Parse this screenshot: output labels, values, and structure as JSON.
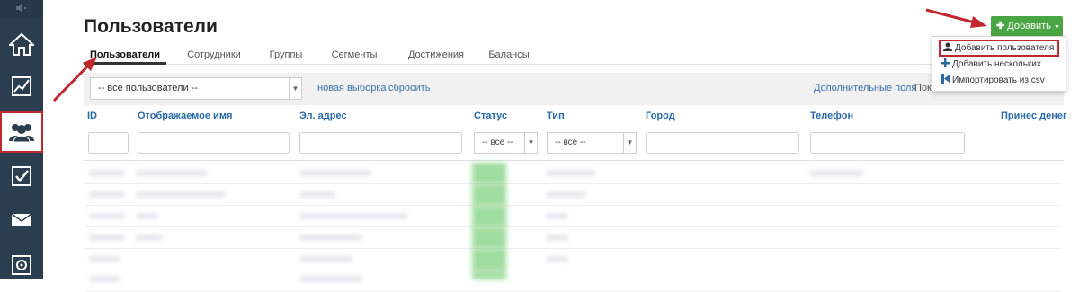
{
  "sidebar": {
    "items": [
      {
        "icon": "home-icon"
      },
      {
        "icon": "chart-icon"
      },
      {
        "icon": "users-icon",
        "active": true
      },
      {
        "icon": "checkbox-icon"
      },
      {
        "icon": "mail-icon"
      },
      {
        "icon": "safe-icon"
      }
    ]
  },
  "page": {
    "title": "Пользователи"
  },
  "tabs": [
    "Пользователи",
    "Сотрудники",
    "Группы",
    "Сегменты",
    "Достижения",
    "Балансы"
  ],
  "filter": {
    "select_value": "-- все пользователи --",
    "new_selection": "новая выборка",
    "reset": "сбросить",
    "extra_fields": "Дополнительные поля",
    "show_truncated": "Пок"
  },
  "table": {
    "headers": [
      "ID",
      "Отображаемое имя",
      "Эл. адрес",
      "Статус",
      "Тип",
      "Город",
      "Телефон",
      "Принес денег"
    ],
    "status_filter": "-- все --",
    "type_filter": "-- все --"
  },
  "add_button": {
    "label": "Добавить",
    "menu": [
      {
        "label": "Добавить пользователя",
        "icon": "user-icon"
      },
      {
        "label": "Добавить нескольких",
        "icon": "plus-icon"
      },
      {
        "label": "Импортировать из csv",
        "icon": "import-icon"
      }
    ]
  },
  "colors": {
    "sidebar_bg": "#2b3e50",
    "accent_green": "#4aa544",
    "annotation_red": "#c0282d",
    "link_blue": "#2a6aa6"
  }
}
